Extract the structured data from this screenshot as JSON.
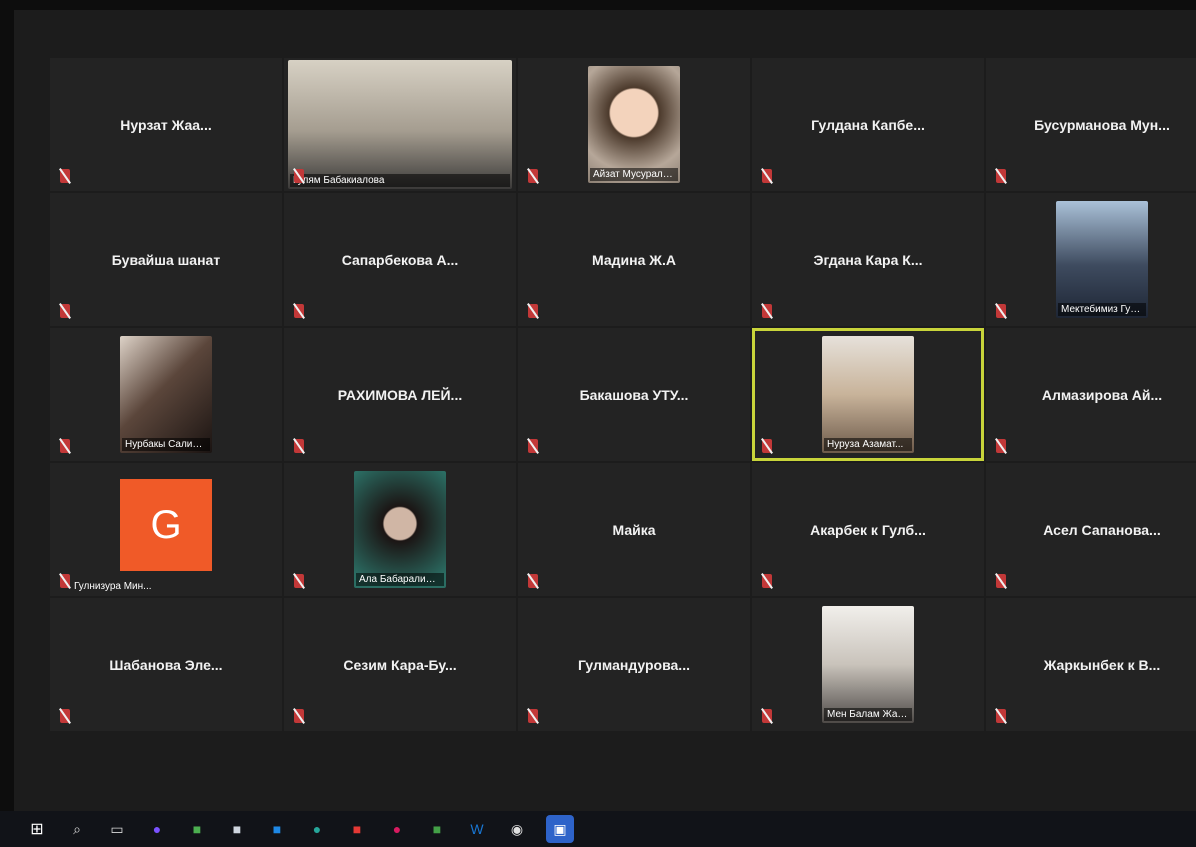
{
  "participants": [
    {
      "name": "Нурзат Жаа...",
      "video": false
    },
    {
      "name": "Гулям Бабакиалова",
      "video": true,
      "kind": "office"
    },
    {
      "name": "Айзат Мусуралиева",
      "video": true,
      "kind": "face"
    },
    {
      "name": "Гулдана Капбе...",
      "video": false
    },
    {
      "name": "Бусурманова Мун...",
      "video": false
    },
    {
      "name": "Бувайша шанат",
      "video": false
    },
    {
      "name": "Сапарбекова А...",
      "video": false
    },
    {
      "name": "Мадина Ж.А",
      "video": false
    },
    {
      "name": "Эгдана Кара К...",
      "video": false
    },
    {
      "name": "Мектебимиз Гур...",
      "video": true,
      "kind": "group"
    },
    {
      "name": "Нурбакы Салим...",
      "video": true,
      "kind": "selfie"
    },
    {
      "name": "РАХИМОВА ЛЕЙ...",
      "video": false
    },
    {
      "name": "Бакашова УТУ...",
      "video": false
    },
    {
      "name": "Нуруза Азамат...",
      "video": true,
      "kind": "blonde",
      "active": true
    },
    {
      "name": "Алмазирова Ай...",
      "video": false
    },
    {
      "name": "Гулнизура Мин...",
      "avatar": "G"
    },
    {
      "name": "Ала Бабаралиева",
      "video": true,
      "kind": "dark"
    },
    {
      "name": "Майка",
      "video": false
    },
    {
      "name": "Акарбек к Гулб...",
      "video": false
    },
    {
      "name": "Асел Сапанова...",
      "video": false
    },
    {
      "name": "Шабанова Эле...",
      "video": false
    },
    {
      "name": "Сезим Кара-Бу...",
      "video": false
    },
    {
      "name": "Гулмандурова...",
      "video": false
    },
    {
      "name": "Мен Балам Жаны",
      "video": true,
      "kind": "room"
    },
    {
      "name": "Жаркынбек к В...",
      "video": false
    }
  ],
  "taskbar": [
    {
      "name": "windows-start-icon",
      "glyph": "⊞"
    },
    {
      "name": "search-icon",
      "glyph": "⌕"
    },
    {
      "name": "task-view-icon",
      "glyph": "▭"
    },
    {
      "name": "app-purple-icon",
      "glyph": "●",
      "color": "#7a52ff"
    },
    {
      "name": "app-green-icon",
      "glyph": "■",
      "color": "#4caf50"
    },
    {
      "name": "store-icon",
      "glyph": "■",
      "color": "#cfd6df"
    },
    {
      "name": "mail-icon",
      "glyph": "■",
      "color": "#1e88e5"
    },
    {
      "name": "edge-icon",
      "glyph": "●",
      "color": "#26a69a"
    },
    {
      "name": "app-red-icon",
      "glyph": "■",
      "color": "#e53935"
    },
    {
      "name": "app-pink-icon",
      "glyph": "●",
      "color": "#d81b60"
    },
    {
      "name": "sheets-icon",
      "glyph": "■",
      "color": "#43a047"
    },
    {
      "name": "word-icon",
      "glyph": "W",
      "color": "#1976d2"
    },
    {
      "name": "chrome-icon",
      "glyph": "◉",
      "color": "#e0e0e0"
    },
    {
      "name": "zoom-icon",
      "glyph": "▣",
      "color": "#ffffff",
      "active": true
    }
  ]
}
